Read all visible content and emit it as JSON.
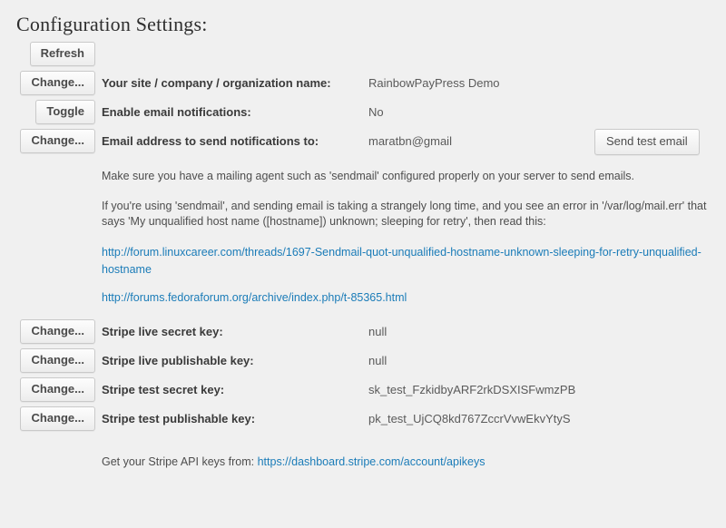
{
  "page": {
    "title": "Configuration Settings:",
    "background_color": "#f0f0f0",
    "link_color": "#1b7cb8"
  },
  "toolbar": {
    "refresh_label": "Refresh"
  },
  "settings_rows": [
    {
      "button": "Change...",
      "label": "Your site / company / organization name:",
      "value": "RainbowPayPress Demo"
    },
    {
      "button": "Toggle",
      "label": "Enable email notifications:",
      "value": "No"
    },
    {
      "button": "Change...",
      "label": "Email address to send notifications to:",
      "value": "maratbn@gmail",
      "action": "Send test email"
    }
  ],
  "notes": {
    "mailing_agent": "Make sure you have a mailing agent such as 'sendmail' configured properly on your server to send emails.",
    "sendmail_issue": "If you're using 'sendmail', and sending email is taking a strangely long time, and you see an error in '/var/log/mail.err' that says 'My unqualified host name ([hostname]) unknown; sleeping for retry', then read this:"
  },
  "links": [
    "http://forum.linuxcareer.com/threads/1697-Sendmail-quot-unqualified-hostname-unknown-sleeping-for-retry-unqualified-hostname",
    "http://forums.fedoraforum.org/archive/index.php/t-85365.html"
  ],
  "stripe_rows": [
    {
      "button": "Change...",
      "label": "Stripe live secret key:",
      "value": "null"
    },
    {
      "button": "Change...",
      "label": "Stripe live publishable key:",
      "value": "null"
    },
    {
      "button": "Change...",
      "label": "Stripe test secret key:",
      "value": "sk_test_FzkidbyARF2rkDSXISFwmzPB"
    },
    {
      "button": "Change...",
      "label": "Stripe test publishable key:",
      "value": "pk_test_UjCQ8kd767ZccrVvwEkvYtyS"
    }
  ],
  "footer": {
    "text": "Get your Stripe API keys from:",
    "link": "https://dashboard.stripe.com/account/apikeys"
  }
}
